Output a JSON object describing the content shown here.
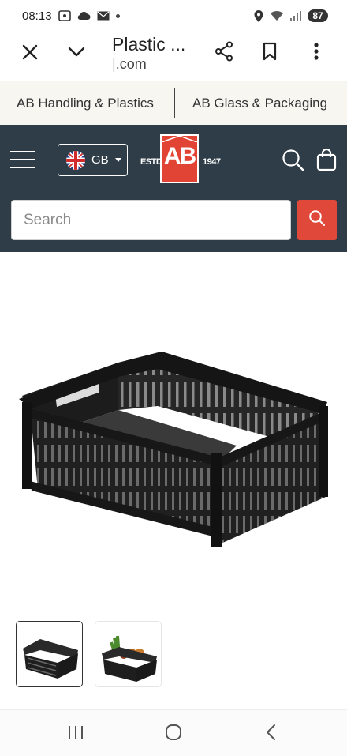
{
  "status_bar": {
    "time": "08:13",
    "battery": "87"
  },
  "browser": {
    "page_title": "Plastic ...",
    "domain_prefix": "|",
    "domain": ".com"
  },
  "sister_sites": [
    {
      "label": "AB Handling & Plastics"
    },
    {
      "label": "AB Glass & Packaging"
    }
  ],
  "header": {
    "region_label": "GB",
    "logo": {
      "left": "ESTD",
      "center": "AB",
      "right": "1947"
    },
    "search_placeholder": "Search"
  },
  "product": {
    "image": "black-plastic-vented-crate",
    "thumbnails": [
      {
        "name": "empty-crate-thumbnail",
        "selected": true
      },
      {
        "name": "crate-with-vegetables-thumbnail",
        "selected": false
      }
    ]
  },
  "colors": {
    "header_bg": "#2e3d47",
    "accent": "#e0493a",
    "sister_bar_bg": "#f7f6f1"
  },
  "icons": {
    "close": "close-icon",
    "collapse": "chevron-down-icon",
    "share": "share-icon",
    "bookmark": "bookmark-icon",
    "more": "more-vert-icon",
    "menu": "hamburger-icon",
    "search": "search-icon",
    "cart": "shopping-bag-icon",
    "nav_recents": "recents-icon",
    "nav_home": "home-icon",
    "nav_back": "back-icon"
  }
}
